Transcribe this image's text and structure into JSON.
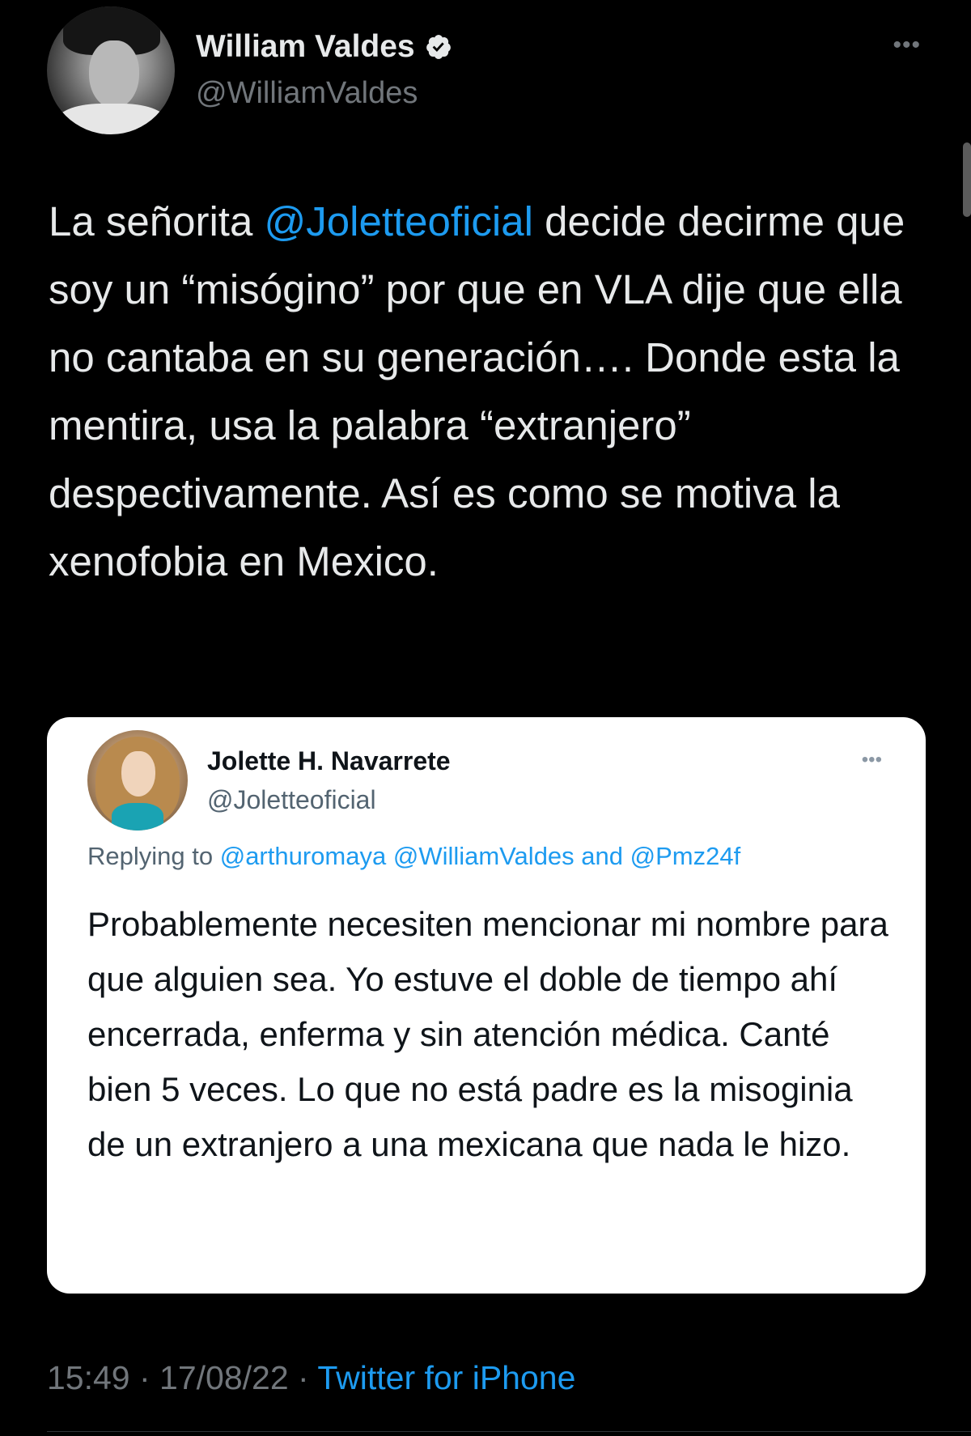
{
  "author": {
    "name": "William Valdes",
    "handle": "@WilliamValdes",
    "verified_icon": "verified-badge-icon",
    "avatar_icon": "avatar"
  },
  "tweet": {
    "text_before_mention": "La señorita ",
    "mention": "@Joletteoficial",
    "text_after_mention": " decide decirme que soy un “misógino” por que en VLA dije que ella no cantaba en su generación…. Donde esta la mentira, usa la palabra “extranjero” despectivamente. Así es como se motiva la xenofobia en Mexico."
  },
  "quoted_tweet": {
    "name": "Jolette H. Navarrete",
    "handle": "@Joletteoficial",
    "replying_prefix": "Replying to ",
    "replying_mention_1": "@arthuromaya",
    "replying_mention_2": "@WilliamValdes",
    "replying_and": " and ",
    "replying_mention_3": "@Pmz24f",
    "text": "Probablemente necesiten mencionar mi nombre para que alguien sea. Yo estuve el doble de tiempo ahí encerrada, enferma y sin atención médica. Canté bien 5 veces. Lo que no está padre es la misoginia de un extranjero a una mexicana que nada le hizo."
  },
  "meta": {
    "time": "15:49",
    "separator": " · ",
    "date": "17/08/22",
    "source": "Twitter for iPhone"
  },
  "colors": {
    "background": "#000000",
    "link": "#1d9bf0",
    "secondary_text": "#71767b",
    "card_background": "#ffffff"
  }
}
